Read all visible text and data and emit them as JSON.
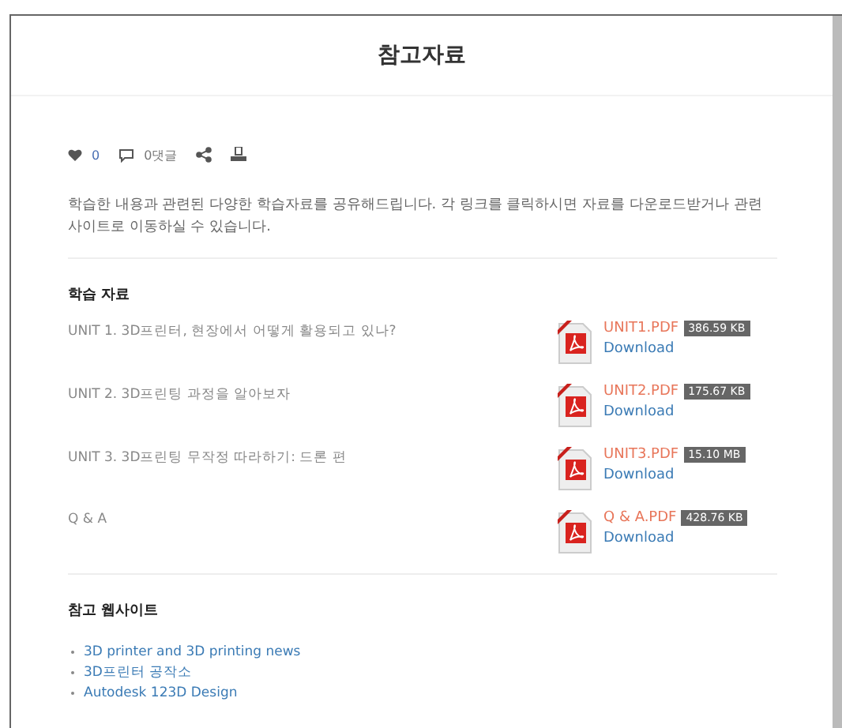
{
  "page": {
    "title": "참고자료"
  },
  "meta": {
    "likes": "0",
    "comments": "0댓글"
  },
  "description": "학습한 내용과 관련된 다양한 학습자료를 공유해드립니다. 각 링크를 클릭하시면 자료를 다운로드받거나 관련 사이트로 이동하실 수 있습니다.",
  "materials": {
    "heading": "학습 자료",
    "items": [
      {
        "title": "UNIT 1. 3D프린터, 현장에서 어떻게 활용되고 있나?",
        "file": "UNIT1.PDF",
        "size": "386.59 KB",
        "action": "Download"
      },
      {
        "title": "UNIT 2. 3D프린팅 과정을 알아보자",
        "file": "UNIT2.PDF",
        "size": "175.67 KB",
        "action": "Download"
      },
      {
        "title": "UNIT 3. 3D프린팅 무작정 따라하기: 드론 편",
        "file": "UNIT3.PDF",
        "size": "15.10 MB",
        "action": "Download"
      },
      {
        "title": "Q & A",
        "file": "Q & A.PDF",
        "size": "428.76 KB",
        "action": "Download"
      }
    ]
  },
  "websites": {
    "heading": "참고 웹사이트",
    "links": [
      "3D printer and 3D printing news",
      "3D프린터 공작소",
      "Autodesk 123D Design"
    ]
  }
}
